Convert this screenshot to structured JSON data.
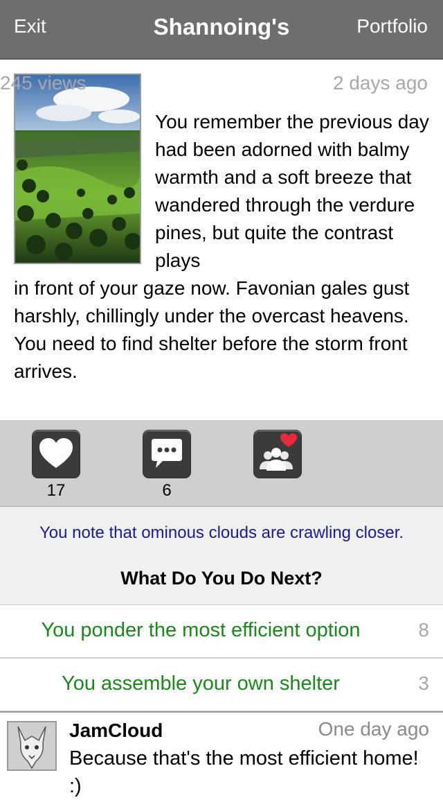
{
  "nav": {
    "left": "Exit",
    "title": "Shannoing's",
    "right": "Portfolio"
  },
  "story": {
    "views": "245 views",
    "posted": "2 days ago",
    "text_wrapped": "You remember the previous day had been adorned with balmy warmth and a soft breeze that wandered through the verdure pines, but quite the contrast plays",
    "text_full": "in front of your gaze now. Favonian gales gust harshly, chillingly under the overcast heavens. You need to find shelter before the storm front arrives."
  },
  "actions": {
    "like_icon": "heart-icon",
    "like_count": "17",
    "comment_icon": "speech-bubble-icon",
    "comment_count": "6",
    "follow_icon": "people-heart-icon"
  },
  "prompt": {
    "narration": "You note that ominous clouds are crawling closer.",
    "question": "What Do You Do Next?"
  },
  "choices": [
    {
      "label": "You ponder the most efficient option",
      "count": "8"
    },
    {
      "label": "You assemble your own shelter",
      "count": "3"
    }
  ],
  "comment": {
    "user": "JamCloud",
    "time": "One day ago",
    "text": "Because that's the most efficient home! :)"
  },
  "colors": {
    "navbar": "#6e6e6e",
    "action_bar": "#cfcfcf",
    "narration": "#1a1a9a",
    "choice": "#188a18",
    "muted": "#a8a8a8",
    "heart_badge": "#e8293b"
  }
}
